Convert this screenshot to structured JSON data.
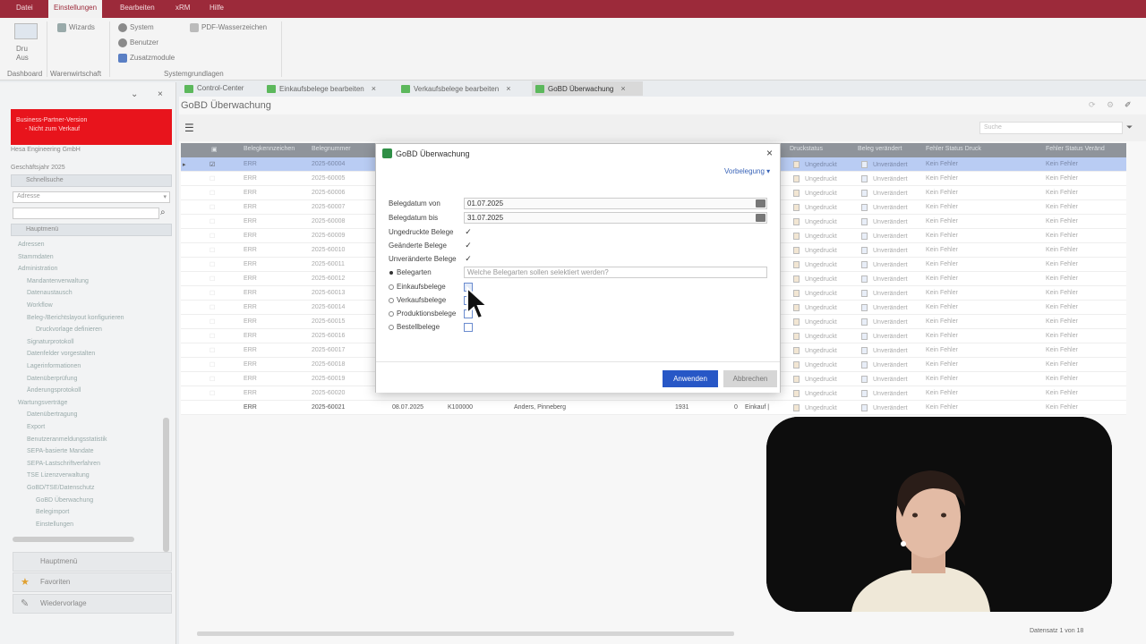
{
  "menu": {
    "tabs": [
      "Datei",
      "Einstellungen",
      "Bearbeiten",
      "xRM",
      "Hilfe"
    ]
  },
  "ribbon": {
    "aktualisieren": "Dru Aus",
    "wizard": "Wizards",
    "system": "System",
    "benutzer": "Benutzer",
    "zusatzmodule": "Zusatzmodule",
    "pdf": "PDF-Wasserzeichen",
    "group_dashboard": "Dashboard",
    "group_warenwirtschaft": "Warenwirtschaft",
    "group_system": "Systemgrundlagen"
  },
  "left": {
    "banner_line1": "Business-Partner-Version",
    "banner_line2": "- Nicht zum Verkauf",
    "company": "Hesa Engineering GmbH",
    "year": "Geschäftsjahr 2025",
    "schnellsuche": "Schnellsuche",
    "select": "Adresse",
    "modules": "Hauptmenü",
    "tree": [
      "Adressen",
      "Stammdaten",
      "Administration",
      "Mandantenverwaltung",
      "Datenaustausch",
      "Workflow",
      "Beleg-/Berichtslayout konfigurieren",
      "Druckvorlage definieren",
      "Signaturprotokoll",
      "Datenfelder vorgestalten",
      "Lagerinformationen",
      "Datenüberprüfung",
      "Änderungsprotokoll",
      "Wartungsverträge",
      "Datenübertragung",
      "Export",
      "Benutzeranmeldungsstatistik",
      "SEPA-basierte Mandate",
      "SEPA-Lastschriftverfahren",
      "TSE Lizenzverwaltung",
      "GoBD/TSE/Datenschutz",
      "GoBD Überwachung",
      "Belegimport",
      "Einstellungen"
    ],
    "footer": [
      "Hauptmenü",
      "Favoriten",
      "Wiedervorlage"
    ]
  },
  "tabs": [
    {
      "label": "Control-Center",
      "closable": false,
      "active": false
    },
    {
      "label": "Einkaufsbelege bearbeiten",
      "closable": true,
      "active": false
    },
    {
      "label": "Verkaufsbelege bearbeiten",
      "closable": true,
      "active": false
    },
    {
      "label": "GoBD Überwachung",
      "closable": true,
      "active": true
    }
  ],
  "main": {
    "title": "GoBD Überwachung",
    "filter_placeholder": "Suche",
    "columns": [
      "Belegkennzeichen",
      "Belegnummer",
      "Druckstatus",
      "Beleg verändert",
      "Fehler Status Druck",
      "Fehler Status Veränd"
    ],
    "rows": [
      {
        "kz": "ERR",
        "nr": "2025-60004",
        "druck": "Ungedruckt",
        "verand": "Unverändert",
        "f1": "Kein Fehler",
        "f2": "Kein Fehler"
      },
      {
        "kz": "ERR",
        "nr": "2025-60005",
        "druck": "Ungedruckt",
        "verand": "Unverändert",
        "f1": "Kein Fehler",
        "f2": "Kein Fehler"
      },
      {
        "kz": "ERR",
        "nr": "2025-60006",
        "druck": "Ungedruckt",
        "verand": "Unverändert",
        "f1": "Kein Fehler",
        "f2": "Kein Fehler"
      },
      {
        "kz": "ERR",
        "nr": "2025-60007",
        "druck": "Ungedruckt",
        "verand": "Unverändert",
        "f1": "Kein Fehler",
        "f2": "Kein Fehler"
      },
      {
        "kz": "ERR",
        "nr": "2025-60008",
        "druck": "Ungedruckt",
        "verand": "Unverändert",
        "f1": "Kein Fehler",
        "f2": "Kein Fehler"
      },
      {
        "kz": "ERR",
        "nr": "2025-60009",
        "druck": "Ungedruckt",
        "verand": "Unverändert",
        "f1": "Kein Fehler",
        "f2": "Kein Fehler"
      },
      {
        "kz": "ERR",
        "nr": "2025-60010",
        "druck": "Ungedruckt",
        "verand": "Unverändert",
        "f1": "Kein Fehler",
        "f2": "Kein Fehler"
      },
      {
        "kz": "ERR",
        "nr": "2025-60011",
        "druck": "Ungedruckt",
        "verand": "Unverändert",
        "f1": "Kein Fehler",
        "f2": "Kein Fehler"
      },
      {
        "kz": "ERR",
        "nr": "2025-60012",
        "druck": "Ungedruckt",
        "verand": "Unverändert",
        "f1": "Kein Fehler",
        "f2": "Kein Fehler"
      },
      {
        "kz": "ERR",
        "nr": "2025-60013",
        "druck": "Ungedruckt",
        "verand": "Unverändert",
        "f1": "Kein Fehler",
        "f2": "Kein Fehler"
      },
      {
        "kz": "ERR",
        "nr": "2025-60014",
        "druck": "Ungedruckt",
        "verand": "Unverändert",
        "f1": "Kein Fehler",
        "f2": "Kein Fehler"
      },
      {
        "kz": "ERR",
        "nr": "2025-60015",
        "druck": "Ungedruckt",
        "verand": "Unverändert",
        "f1": "Kein Fehler",
        "f2": "Kein Fehler"
      },
      {
        "kz": "ERR",
        "nr": "2025-60016",
        "druck": "Ungedruckt",
        "verand": "Unverändert",
        "f1": "Kein Fehler",
        "f2": "Kein Fehler"
      },
      {
        "kz": "ERR",
        "nr": "2025-60017",
        "druck": "Ungedruckt",
        "verand": "Unverändert",
        "f1": "Kein Fehler",
        "f2": "Kein Fehler"
      },
      {
        "kz": "ERR",
        "nr": "2025-60018",
        "druck": "Ungedruckt",
        "verand": "Unverändert",
        "f1": "Kein Fehler",
        "f2": "Kein Fehler"
      },
      {
        "kz": "ERR",
        "nr": "2025-60019",
        "druck": "Ungedruckt",
        "verand": "Unverändert",
        "f1": "Kein Fehler",
        "f2": "Kein Fehler"
      },
      {
        "kz": "ERR",
        "nr": "2025-60020",
        "druck": "Ungedruckt",
        "verand": "Unverändert",
        "f1": "Kein Fehler",
        "f2": "Kein Fehler"
      }
    ],
    "last_row": {
      "kz": "ERR",
      "nr": "2025-60021",
      "datum": "08.07.2025",
      "kunde": "K100000",
      "name": "Anders, Pinneberg",
      "num": "1931",
      "zero": "0",
      "art": "Einkauf |",
      "druck": "Ungedruckt",
      "verand": "Unverändert",
      "f1": "Kein Fehler",
      "f2": "Kein Fehler"
    },
    "status": "Datensatz 1 von 18"
  },
  "dialog": {
    "title": "GoBD Überwachung",
    "vorbelegung": "Vorbelegung",
    "belegdatum_von_label": "Belegdatum von",
    "belegdatum_von": "01.07.2025",
    "belegdatum_bis_label": "Belegdatum bis",
    "belegdatum_bis": "31.07.2025",
    "ungedruckte": "Ungedruckte Belege",
    "geaenderte": "Geänderte Belege",
    "unveraenderte": "Unveränderte Belege",
    "belegarten": "Belegarten",
    "belegarten_placeholder": "Welche Belegarten sollen selektiert werden?",
    "einkauf": "Einkaufsbelege",
    "verkauf": "Verkaufsbelege",
    "produktion": "Produktionsbelege",
    "bestell": "Bestellbelege",
    "apply": "Anwenden",
    "cancel": "Abbrechen"
  }
}
